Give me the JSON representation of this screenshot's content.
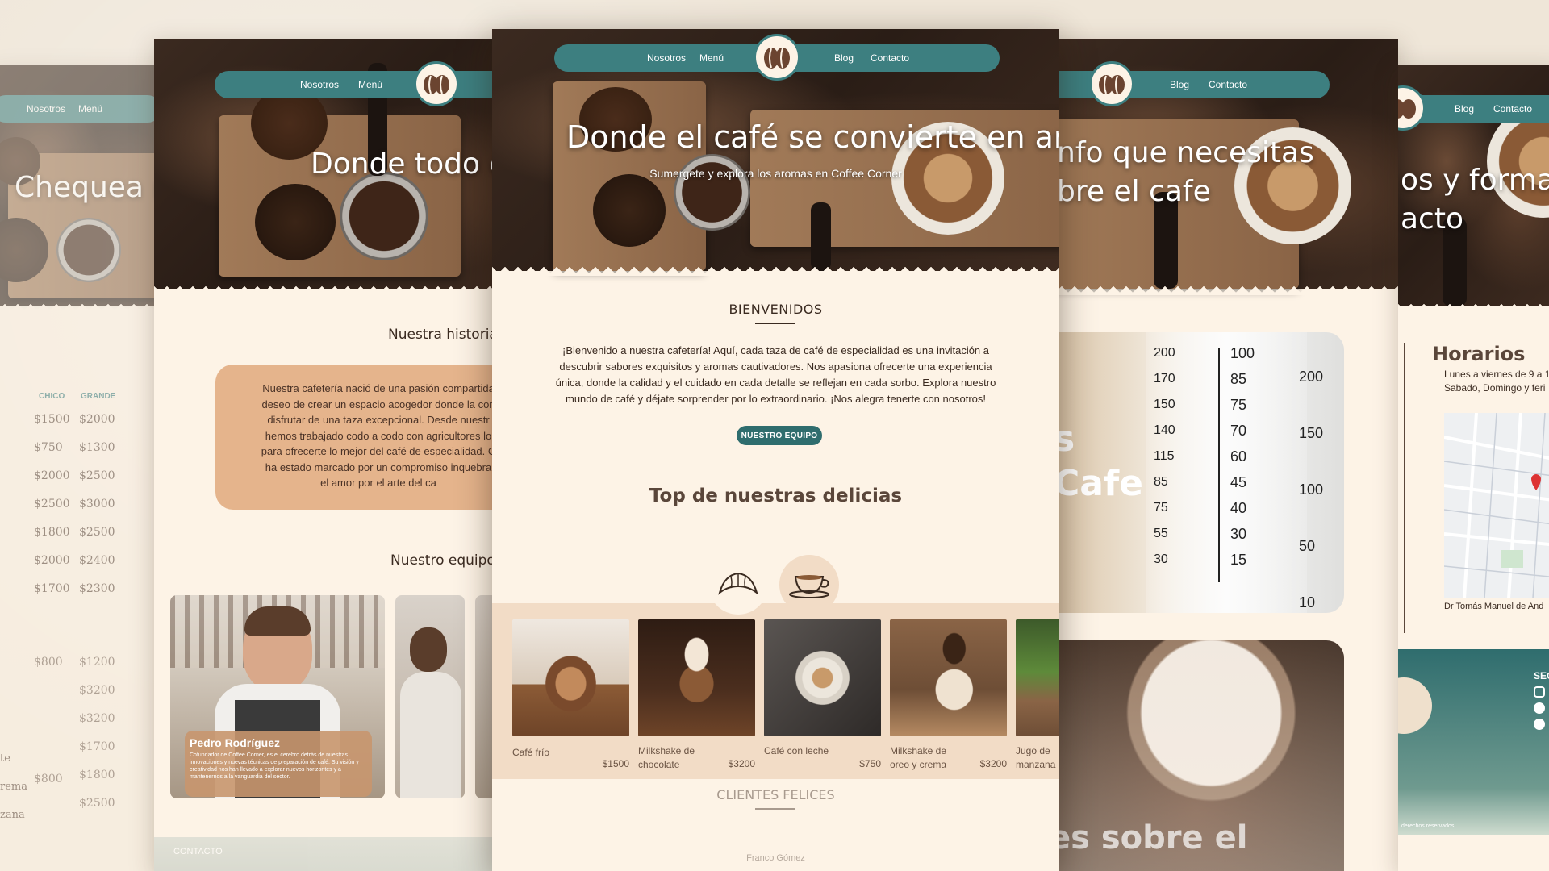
{
  "nav": {
    "nosotros": "Nosotros",
    "menu": "Menú",
    "blog": "Blog",
    "contacto": "Contacto"
  },
  "page_menu": {
    "hero_title": "Chequea nu",
    "size_small": "CHICO",
    "size_large": "GRANDE",
    "prices_small": [
      "$1500",
      "$750",
      "$2000",
      "$2500",
      "$1800",
      "$2000",
      "$1700"
    ],
    "prices_large": [
      "$2000",
      "$1300",
      "$2500",
      "$3000",
      "$2500",
      "$2400",
      "$2300"
    ],
    "prices_small_2": [
      "$800",
      "",
      "",
      "",
      "$800"
    ],
    "prices_large_2": [
      "$1200",
      "$3200",
      "$3200",
      "$1700",
      "$1800",
      "$2500"
    ],
    "items_2": [
      "te",
      "rema",
      "zana"
    ]
  },
  "page_nosotros": {
    "hero_title": "Donde todo em",
    "history_title": "Nuestra historia",
    "history_lines": [
      "Nuestra cafetería nació de una pasión compartida",
      "deseo de crear un espacio acogedor donde la con",
      "disfrutar de una taza excepcional. Desde nuestr",
      "hemos trabajado codo a codo con agricultores lo",
      "para ofrecerte lo mejor del café de especialidad. C",
      "ha estado marcado por un compromiso inquebra",
      "el amor por el arte del ca"
    ],
    "team_title": "Nuestro equipo",
    "member_name": "Pedro Rodríguez",
    "member_bio": "Cofundador de Coffee Corner, es el cerebro detrás de nuestras innovaciones y nuevas técnicas de preparación de café. Su visión y creatividad nos han llevado a explorar nuevos horizontes y a mantenernos a la vanguardia del sector.",
    "footer_label": "CONTACTO"
  },
  "page_home": {
    "hero_title": "Donde el café se convierte en arte",
    "hero_subtitle": "Sumergete y explora los aromas en Coffee Corner",
    "welcome_title": "BIENVENIDOS",
    "welcome_lines": [
      "¡Bienvenido a nuestra cafetería! Aquí, cada taza de café de especialidad es una invitación a",
      "descubrir sabores exquisitos y aromas cautivadores. Nos apasiona ofrecerte una experiencia",
      "única, donde la calidad y el cuidado en cada detalle se reflejan en cada sorbo. Explora nuestro",
      "mundo de café y déjate sorprender por lo extraordinario. ¡Nos alegra tenerte con nosotros!"
    ],
    "team_button": "NUESTRO EQUIPO",
    "top_title": "Top de nuestras delicias",
    "products": [
      {
        "name": "Café frío",
        "price": "$1500"
      },
      {
        "name": "Milkshake de chocolate",
        "price": "$3200"
      },
      {
        "name": "Café con leche",
        "price": "$750"
      },
      {
        "name": "Milkshake de oreo y crema",
        "price": "$3200"
      },
      {
        "name": "Jugo de manzana",
        "price": ""
      }
    ],
    "clients_title": "CLIENTES FELICES",
    "client_name": "Franco Gómez"
  },
  "page_blog": {
    "hero_line1": "nfo que necesitas",
    "hero_line2": "bre el cafe",
    "card1_a": "s",
    "card1_b": "Cafe",
    "card2_title": "es sobre el",
    "cup_labels_left": [
      "200",
      "170",
      "150",
      "140",
      "115",
      "85",
      "75",
      "55",
      "30"
    ],
    "cup_labels_mid": [
      "100",
      "85",
      "75",
      "70",
      "60",
      "45",
      "40",
      "30",
      "15"
    ],
    "cup_labels_right": [
      "200",
      "150",
      "100",
      "50",
      "10"
    ]
  },
  "page_contacto": {
    "hero_line1": "os y formas",
    "hero_line2": "acto",
    "hours_title": "Horarios",
    "hours_line1": "Lunes a viernes de 9 a 1",
    "hours_line2": "Sabado, Domingo y feri",
    "address": "Dr Tomás Manuel de And",
    "social_label": "SEG",
    "footer_note": "derechos reservados"
  },
  "colors": {
    "teal": "#3d7f80",
    "cream": "#fdf3e6",
    "tan": "#e5b48c",
    "brown": "#3a2a20"
  }
}
